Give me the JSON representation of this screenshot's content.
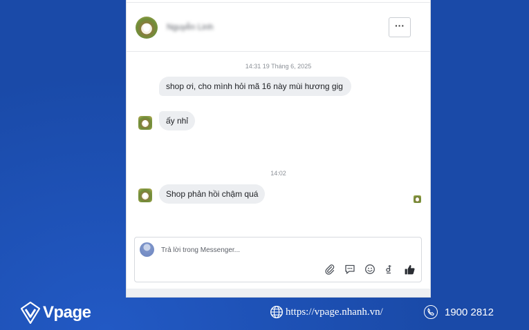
{
  "header": {
    "contact_name": "Nguyễn Linh",
    "more_label": "···"
  },
  "conversation": {
    "timestamp_1": "14:31 19 Tháng 6, 2025",
    "message_1": "shop ơi, cho mình hỏi mã 16 này mùi hương gig",
    "message_2": "ấy nhỉ",
    "timestamp_2": "14:02",
    "message_3": "Shop phản hồi chậm quá"
  },
  "composer": {
    "placeholder": "Trả lời trong Messenger..."
  },
  "toolbar_icons": [
    "paperclip-icon",
    "chat-bubble-icon",
    "emoji-icon",
    "dong-currency-icon",
    "thumbs-up-icon"
  ],
  "footer": {
    "brand": "Vpage",
    "website": "https://vpage.nhanh.vn/",
    "phone": "1900 2812"
  },
  "colors": {
    "background": "#1a4aa8",
    "bubble": "#eceef1",
    "panel": "#ffffff"
  }
}
